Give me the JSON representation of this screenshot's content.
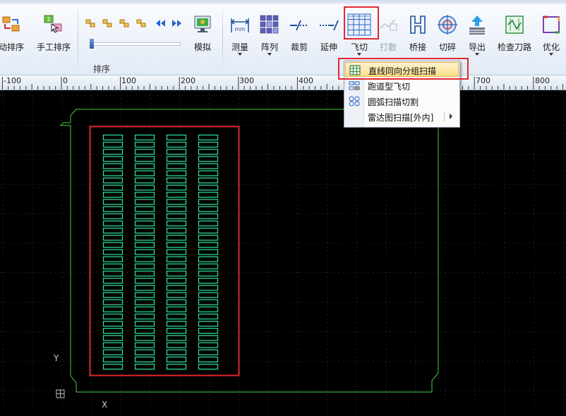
{
  "ribbon": {
    "buttons": {
      "auto_sort": "动排序",
      "manual_sort": "手工排序",
      "simulate": "模拟",
      "measure": "测量",
      "array": "阵列",
      "trim": "裁剪",
      "extend": "延伸",
      "fly_cut": "飞切",
      "break": "打散",
      "bridge": "桥接",
      "cut_chop": "切碎",
      "export": "导出",
      "check_path": "检查刀路",
      "optimize": "优化"
    },
    "group_sort_label": "排序",
    "measure_icon_text": "mm",
    "sort_badge_text": "1",
    "colors": {
      "highlight_border": "#e0282e",
      "hover_fill": "#fbdf89"
    }
  },
  "ruler": {
    "labels": [
      "-100",
      "0",
      "100",
      "200",
      "300",
      "400",
      "700",
      "800"
    ]
  },
  "flycut_menu": {
    "items": [
      {
        "label": "直线同向分组扫描",
        "icon": "grid-scan-icon",
        "active": true
      },
      {
        "label": "跑道型飞切",
        "icon": "racetrack-icon",
        "active": false
      },
      {
        "label": "圆弧扫描切割",
        "icon": "arc-scan-icon",
        "active": false
      },
      {
        "label": "雷达图扫描[外内]",
        "icon": "radar-scan-icon",
        "active": false,
        "has_submenu": true
      }
    ]
  },
  "canvas": {
    "axis_y": "Y",
    "axis_x": "X",
    "part_grid": {
      "columns": 4,
      "rows": 33
    },
    "colors": {
      "background": "#000000",
      "grid_dots": "#3a3a3a",
      "sheet_outline": "#3fd23f",
      "parts": "#2fe59a",
      "selection_box": "#e0282e"
    }
  }
}
